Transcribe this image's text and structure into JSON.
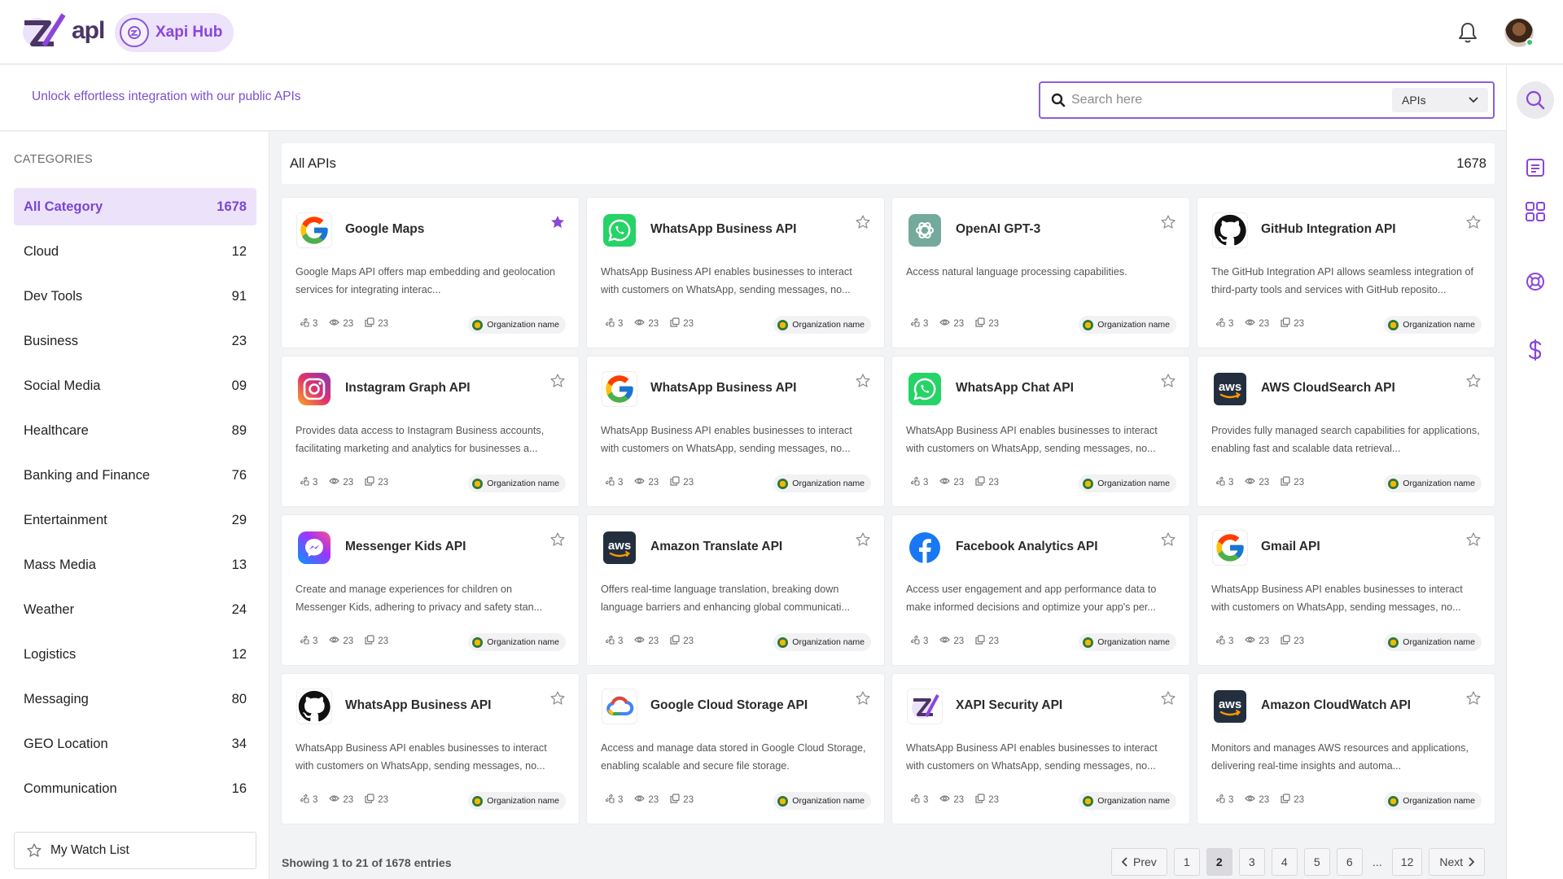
{
  "brand": {
    "logo_text": "apl",
    "hub_label": "Xapi Hub"
  },
  "subheader": {
    "tagline": "Unlock effortless integration with our public APIs"
  },
  "search": {
    "placeholder": "Search here",
    "scope": "APIs"
  },
  "sidebar": {
    "title": "CATEGORIES",
    "items": [
      {
        "label": "All Category",
        "count": "1678"
      },
      {
        "label": "Cloud",
        "count": "12"
      },
      {
        "label": "Dev Tools",
        "count": "91"
      },
      {
        "label": "Business",
        "count": "23"
      },
      {
        "label": "Social Media",
        "count": "09"
      },
      {
        "label": "Healthcare",
        "count": "89"
      },
      {
        "label": "Banking and Finance",
        "count": "76"
      },
      {
        "label": "Entertainment",
        "count": "29"
      },
      {
        "label": "Mass Media",
        "count": "13"
      },
      {
        "label": "Weather",
        "count": "24"
      },
      {
        "label": "Logistics",
        "count": "12"
      },
      {
        "label": "Messaging",
        "count": "80"
      },
      {
        "label": "GEO Location",
        "count": "34"
      },
      {
        "label": "Communication",
        "count": "16"
      }
    ],
    "watchlist_label": "My Watch List"
  },
  "main": {
    "heading": "All APIs",
    "total": "1678"
  },
  "cards": [
    {
      "icon": "google-icon",
      "name": "Google Maps",
      "desc": "Google Maps API offers map embedding and geolocation services for integrating interac...",
      "starred": true,
      "a": "3",
      "b": "23",
      "c": "23",
      "org": "Organization name"
    },
    {
      "icon": "whatsapp-icon",
      "name": "WhatsApp Business API",
      "desc": "WhatsApp Business API enables businesses to interact with customers on WhatsApp, sending messages, no...",
      "starred": false,
      "a": "3",
      "b": "23",
      "c": "23",
      "org": "Organization name"
    },
    {
      "icon": "openai-icon",
      "name": "OpenAI GPT-3",
      "desc": "Access natural language processing capabilities.",
      "starred": false,
      "a": "3",
      "b": "23",
      "c": "23",
      "org": "Organization name"
    },
    {
      "icon": "github-icon",
      "name": "GitHub Integration API",
      "desc": "The GitHub Integration API allows seamless integration of third-party tools and services with GitHub reposito...",
      "starred": false,
      "a": "3",
      "b": "23",
      "c": "23",
      "org": "Organization name"
    },
    {
      "icon": "instagram-icon",
      "name": "Instagram Graph API",
      "desc": "Provides data access to Instagram Business accounts, facilitating marketing and analytics for businesses a...",
      "starred": false,
      "a": "3",
      "b": "23",
      "c": "23",
      "org": "Organization name"
    },
    {
      "icon": "google-icon",
      "name": "WhatsApp Business API",
      "desc": "WhatsApp Business API enables businesses to interact with customers on WhatsApp, sending messages, no...",
      "starred": false,
      "a": "3",
      "b": "23",
      "c": "23",
      "org": "Organization name"
    },
    {
      "icon": "whatsapp-icon",
      "name": "WhatsApp Chat API",
      "desc": "WhatsApp Business API enables businesses to interact with customers on WhatsApp, sending messages, no...",
      "starred": false,
      "a": "3",
      "b": "23",
      "c": "23",
      "org": "Organization name"
    },
    {
      "icon": "aws-icon",
      "name": "AWS CloudSearch API",
      "desc": "Provides fully managed search capabilities for applications, enabling fast and scalable data retrieval...",
      "starred": false,
      "a": "3",
      "b": "23",
      "c": "23",
      "org": "Organization name"
    },
    {
      "icon": "messenger-icon",
      "name": "Messenger Kids API",
      "desc": "Create and manage experiences for children on Messenger Kids, adhering to privacy and safety stan...",
      "starred": false,
      "a": "3",
      "b": "23",
      "c": "23",
      "org": "Organization name"
    },
    {
      "icon": "aws-icon",
      "name": "Amazon Translate API",
      "desc": "Offers real-time language translation, breaking down language barriers and enhancing global communicati...",
      "starred": false,
      "a": "3",
      "b": "23",
      "c": "23",
      "org": "Organization name"
    },
    {
      "icon": "facebook-icon",
      "name": "Facebook Analytics API",
      "desc": "Access user engagement and app performance data to make informed decisions and optimize your app's per...",
      "starred": false,
      "a": "3",
      "b": "23",
      "c": "23",
      "org": "Organization name"
    },
    {
      "icon": "google-icon",
      "name": "Gmail API",
      "desc": "WhatsApp Business API enables businesses to interact with customers on WhatsApp, sending messages, no...",
      "starred": false,
      "a": "3",
      "b": "23",
      "c": "23",
      "org": "Organization name"
    },
    {
      "icon": "github-icon",
      "name": "WhatsApp Business API",
      "desc": "WhatsApp Business API enables businesses to interact with customers on WhatsApp, sending messages, no...",
      "starred": false,
      "a": "3",
      "b": "23",
      "c": "23",
      "org": "Organization name"
    },
    {
      "icon": "google-cloud-icon",
      "name": "Google Cloud Storage API",
      "desc": "Access and manage data stored in Google Cloud Storage, enabling scalable and secure file storage.",
      "starred": false,
      "a": "3",
      "b": "23",
      "c": "23",
      "org": "Organization name"
    },
    {
      "icon": "xapi-icon",
      "name": "XAPI Security API",
      "desc": "WhatsApp Business API enables businesses to interact with customers on WhatsApp, sending messages, no...",
      "starred": false,
      "a": "3",
      "b": "23",
      "c": "23",
      "org": "Organization name"
    },
    {
      "icon": "aws-icon",
      "name": "Amazon CloudWatch API",
      "desc": "Monitors and manages AWS resources and applications, delivering real-time insights and automa...",
      "starred": false,
      "a": "3",
      "b": "23",
      "c": "23",
      "org": "Organization name"
    }
  ],
  "footer": {
    "showing": "Showing 1 to 21 of 1678 entries",
    "prev": "Prev",
    "next": "Next",
    "pages": [
      "1",
      "2",
      "3",
      "4",
      "5",
      "6",
      "...",
      "12"
    ],
    "current_page": "2"
  },
  "colors": {
    "accent": "#8a46d9",
    "accent_bg": "#ece3fb"
  }
}
